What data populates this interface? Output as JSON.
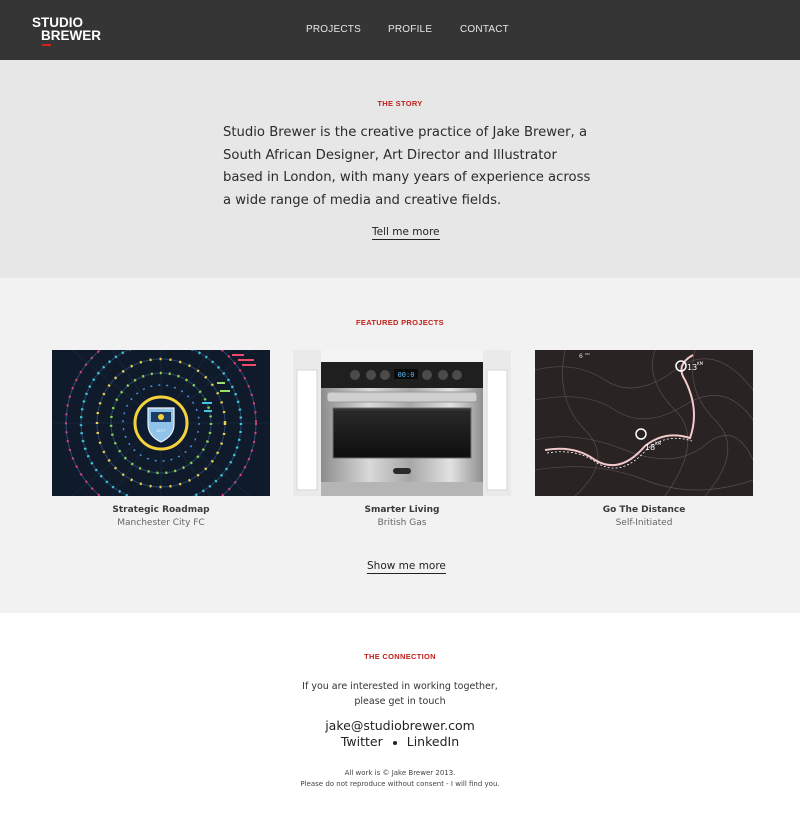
{
  "header": {
    "logo_line1": "STUDIO",
    "logo_line2": "BREWER",
    "nav": [
      {
        "label": "PROJECTS"
      },
      {
        "label": "PROFILE"
      },
      {
        "label": "CONTACT"
      }
    ]
  },
  "story": {
    "label": "THE STORY",
    "text": "Studio Brewer is the creative practice of Jake Brewer, a South African Designer, Art Director and Illustrator based in London, with many years of experience across a wide range of media and creative fields.",
    "more_link": "Tell me more"
  },
  "featured": {
    "label": "FEATURED PROJECTS",
    "projects": [
      {
        "title": "Strategic Roadmap",
        "client": "Manchester City FC"
      },
      {
        "title": "Smarter Living",
        "client": "British Gas"
      },
      {
        "title": "Go The Distance",
        "client": "Self-Initiated"
      }
    ],
    "more_link": "Show me more"
  },
  "connection": {
    "label": "THE CONNECTION",
    "intro_line1": "If you are interested in working together,",
    "intro_line2": "please get in touch",
    "email": "jake@studiobrewer.com",
    "twitter": "Twitter",
    "linkedin": "LinkedIn",
    "footer_line1": "All work is © Jake Brewer 2013.",
    "footer_line2": "Please do not reproduce without consent - I will find you."
  },
  "images": {
    "project1_badge_text": "CITY",
    "project2_oven_display": "00:0",
    "project3_map_labels": [
      "13",
      "KM",
      "18",
      "KM",
      "6",
      "KM"
    ]
  },
  "colors": {
    "header_bg": "#353535",
    "accent_red": "#c0211b",
    "story_bg": "#e7e7e7",
    "featured_bg": "#f2f2f2"
  }
}
